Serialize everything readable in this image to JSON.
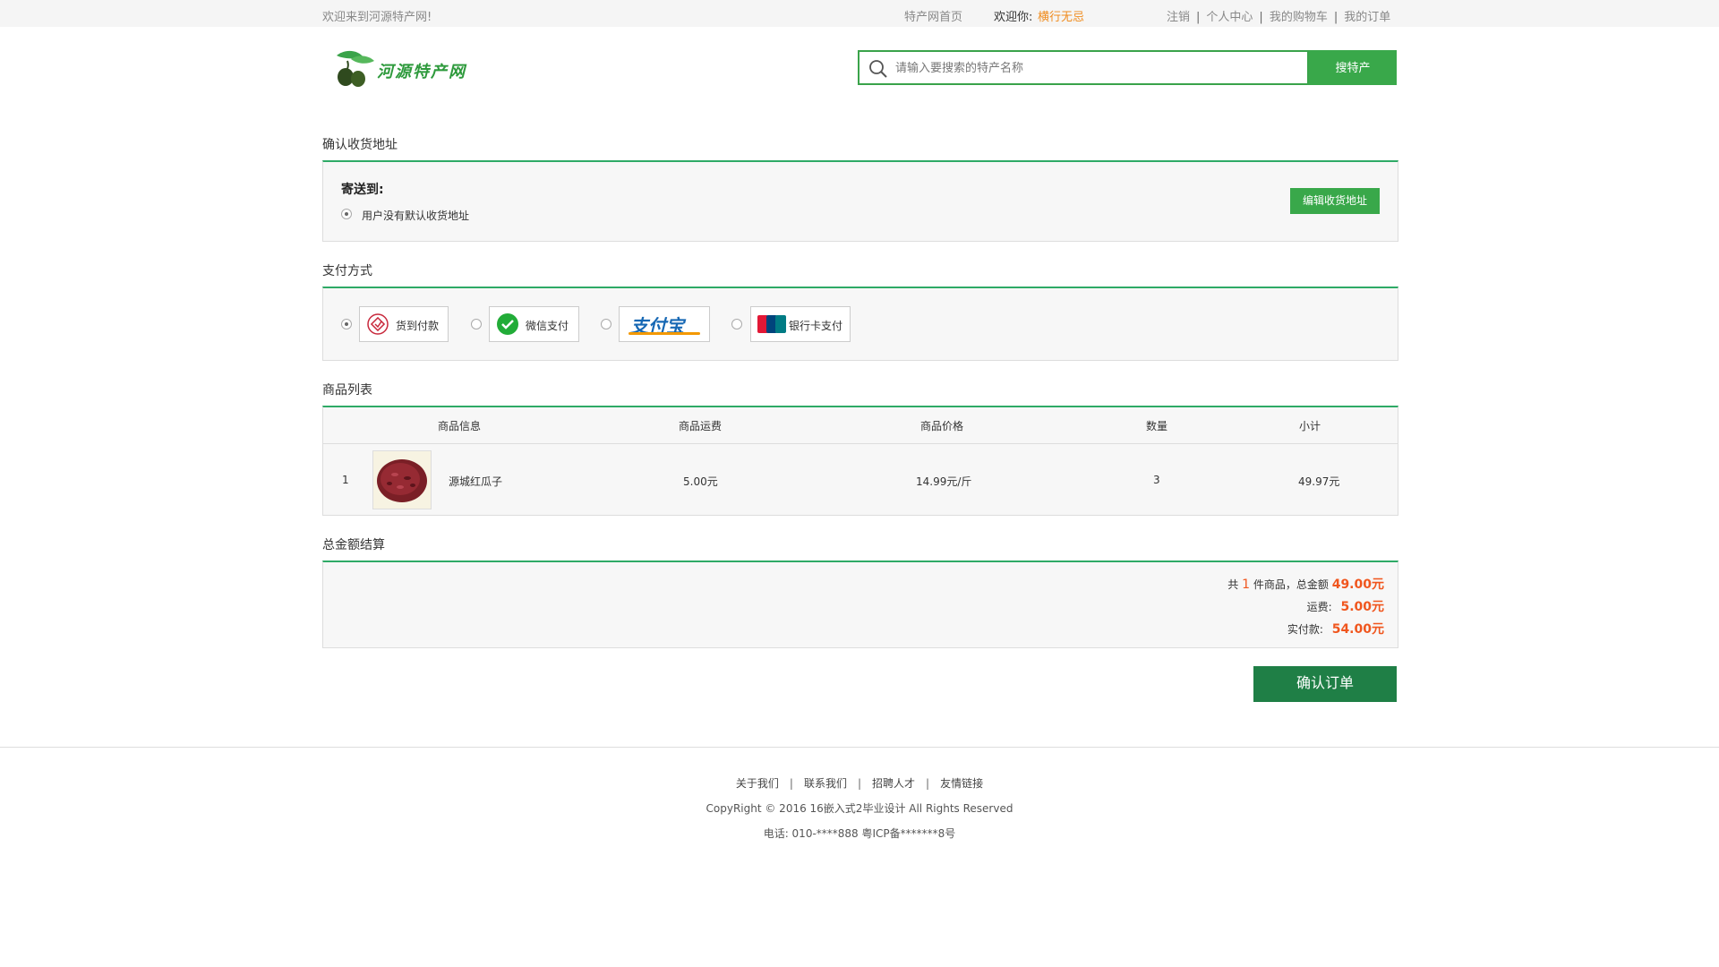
{
  "topbar": {
    "welcome": "欢迎来到河源特产网!",
    "home": "特产网首页",
    "greet": "欢迎你:",
    "username": "横行无忌",
    "links": [
      "注销",
      "个人中心",
      "我的购物车",
      "我的订单"
    ]
  },
  "header": {
    "logo_text": "河源特产网",
    "search_placeholder": "请输入要搜索的特产名称",
    "search_button": "搜特产"
  },
  "address": {
    "title": "确认收货地址",
    "ship_to": "寄送到:",
    "no_default": "用户没有默认收货地址",
    "edit_button": "编辑收货地址"
  },
  "payment": {
    "title": "支付方式",
    "options": [
      {
        "label": "货到付款",
        "icon": "cash-on-delivery-icon",
        "selected": true
      },
      {
        "label": "微信支付",
        "icon": "wechat-pay-icon",
        "selected": false
      },
      {
        "label": "支付宝",
        "icon": "alipay-logo",
        "selected": false
      },
      {
        "label": "银行卡支付",
        "icon": "unionpay-icon",
        "selected": false
      }
    ]
  },
  "products": {
    "title": "商品列表",
    "columns": [
      "商品信息",
      "商品运费",
      "商品价格",
      "数量",
      "小计"
    ],
    "rows": [
      {
        "index": "1",
        "name": "源城红瓜子",
        "shipping": "5.00元",
        "price": "14.99元/斤",
        "qty": "3",
        "subtotal": "49.97元"
      }
    ]
  },
  "summary": {
    "title": "总金额结算",
    "prefix": "共",
    "count": "1",
    "count_suffix": "件商品，总金额",
    "total": "49.00元",
    "shipping_label": "运费:",
    "shipping": "5.00元",
    "paid_label": "实付款:",
    "paid": "54.00元"
  },
  "confirm_button": "确认订单",
  "footer": {
    "links": [
      "关于我们",
      "联系我们",
      "招聘人才",
      "友情链接"
    ],
    "copyright": "CopyRight © 2016 16嵌入式2毕业设计 All Rights Reserved",
    "tel": "电话: 010-****888 粤ICP备*******8号"
  },
  "colors": {
    "brand_green": "#39a84a",
    "accent_green_line": "#2eaa66",
    "confirm_green": "#1f7f46",
    "price_orange": "#f0561e",
    "user_orange": "#f08c1e"
  }
}
